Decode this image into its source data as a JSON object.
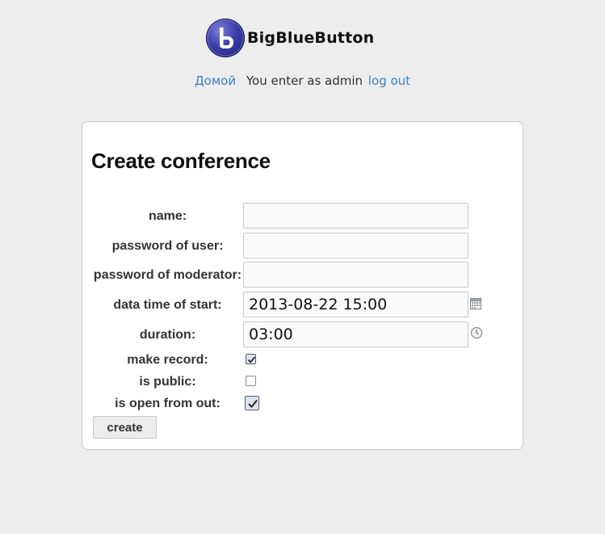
{
  "header": {
    "logo_text": "BigBlueButton",
    "logo_icon": "bigbluebutton-logo-icon"
  },
  "topnav": {
    "home_link": "Домой",
    "user_text": "You enter as admin",
    "logout_link": "log out",
    "link_color": "#3a7fc4"
  },
  "form": {
    "title": "Create conference",
    "fields": {
      "name": {
        "label": "name:",
        "value": ""
      },
      "password_user": {
        "label": "password of user:",
        "value": ""
      },
      "password_moderator": {
        "label": "password of moderator:",
        "value": ""
      },
      "start": {
        "label": "data time of start:",
        "value": "2013-08-22 15:00",
        "icon": "calendar-icon"
      },
      "duration": {
        "label": "duration:",
        "value": "03:00",
        "icon": "clock-icon"
      }
    },
    "checkboxes": {
      "make_record": {
        "label": "make record:",
        "checked": true
      },
      "is_public": {
        "label": "is public:",
        "checked": false
      },
      "is_open": {
        "label": "is open from out:",
        "checked": true
      }
    },
    "submit_label": "create"
  }
}
